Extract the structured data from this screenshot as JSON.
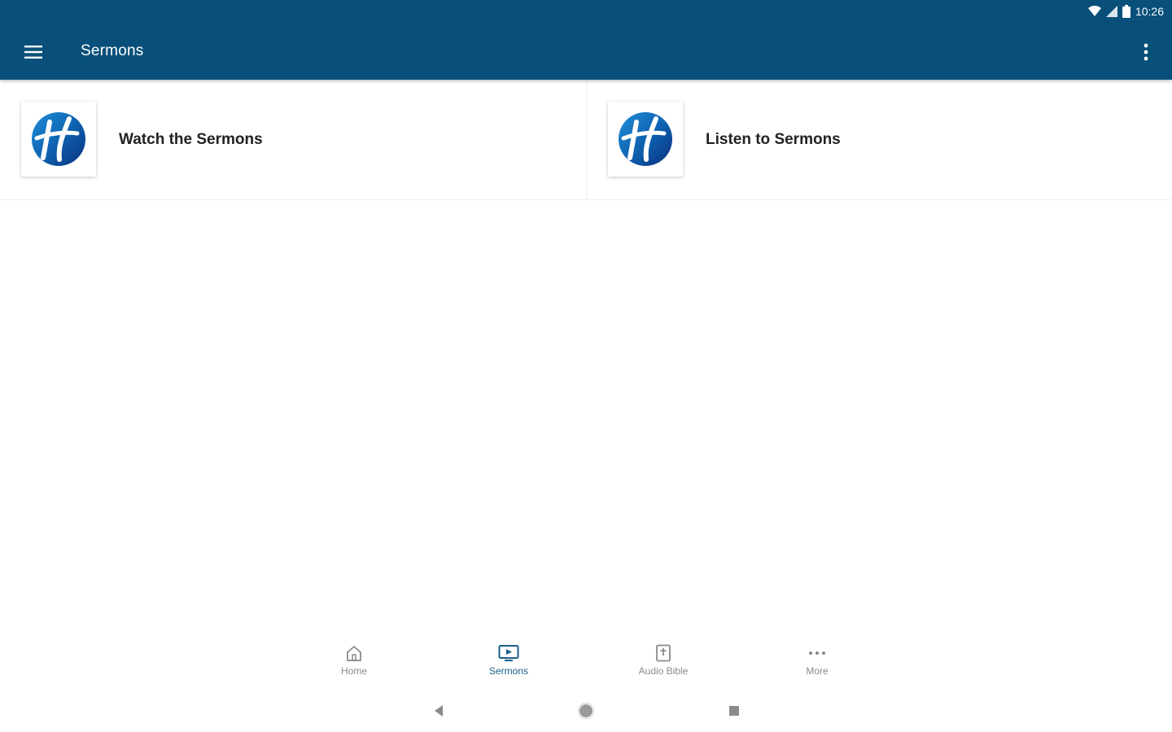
{
  "status_bar": {
    "time": "10:26",
    "icons": [
      "wifi-icon",
      "signal-icon",
      "battery-icon"
    ]
  },
  "app_bar": {
    "title": "Sermons",
    "menu_icon": "hamburger-menu-icon",
    "overflow_icon": "more-vertical-icon",
    "background_color": "#08507a"
  },
  "cards": [
    {
      "label": "Watch the Sermons",
      "icon": "church-logo"
    },
    {
      "label": "Listen to Sermons",
      "icon": "church-logo"
    }
  ],
  "bottom_nav": {
    "items": [
      {
        "label": "Home",
        "icon": "home-icon",
        "active": false
      },
      {
        "label": "Sermons",
        "icon": "tv-icon",
        "active": true
      },
      {
        "label": "Audio Bible",
        "icon": "bible-icon",
        "active": false
      },
      {
        "label": "More",
        "icon": "more-horizontal-icon",
        "active": false
      }
    ],
    "active_color": "#1a5f8c",
    "inactive_color": "#8a8a8a"
  },
  "system_nav": {
    "buttons": [
      "back-icon",
      "home-circle-icon",
      "recents-icon"
    ]
  }
}
